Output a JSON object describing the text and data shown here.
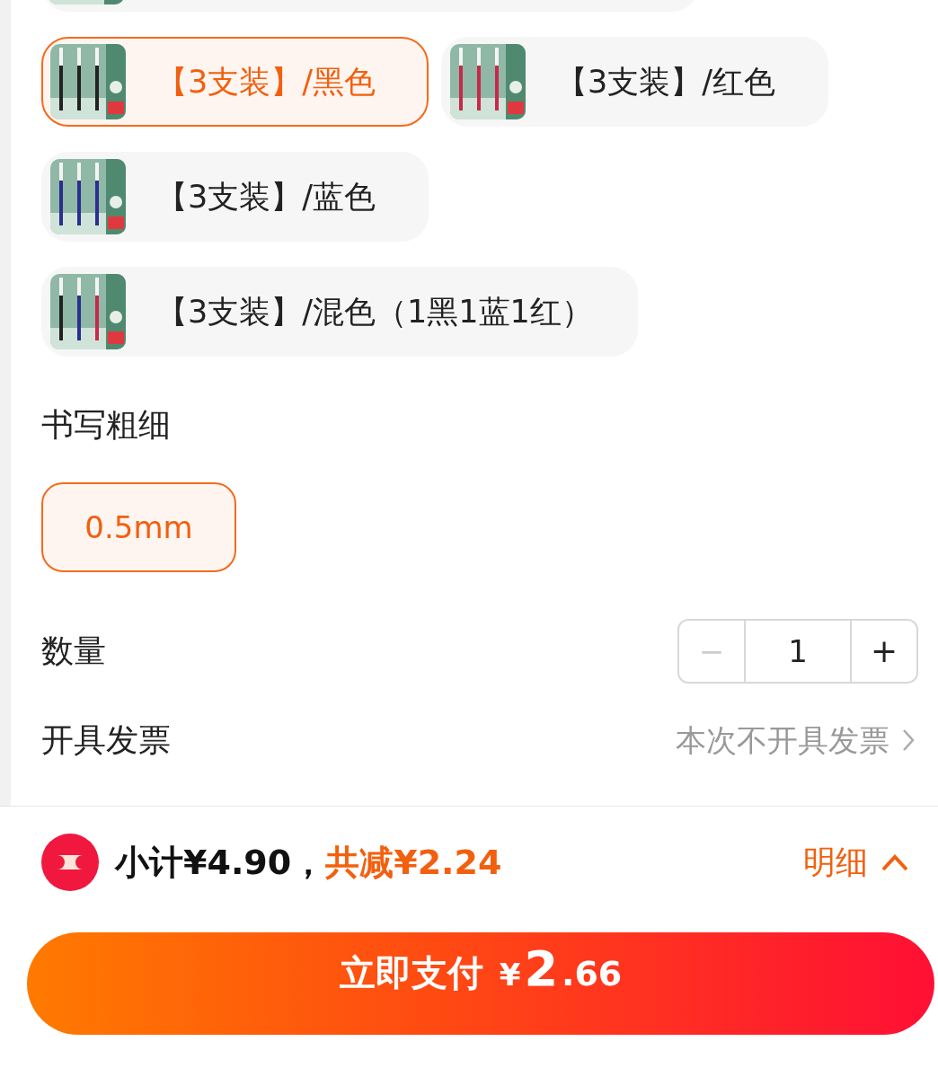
{
  "color_options": [
    {
      "label": "【3支装】/黑色",
      "selected": true
    },
    {
      "label": "【3支装】/红色",
      "selected": false
    },
    {
      "label": "【3支装】/蓝色",
      "selected": false
    },
    {
      "label": "【3支装】/混色（1黑1蓝1红）",
      "selected": false
    }
  ],
  "thickness": {
    "title": "书写粗细",
    "options": [
      {
        "label": "0.5mm",
        "selected": true
      }
    ]
  },
  "quantity": {
    "label": "数量",
    "minus": "−",
    "value": "1",
    "plus": "+",
    "minus_disabled": true
  },
  "invoice": {
    "label": "开具发票",
    "value": "本次不开具发票"
  },
  "summary": {
    "subtotal": "小计¥4.90，",
    "discount": "共减¥2.24",
    "details": "明细"
  },
  "pay_button": {
    "label": "立即支付",
    "currency": "¥",
    "price_integer": "2",
    "price_decimal": ".66"
  }
}
